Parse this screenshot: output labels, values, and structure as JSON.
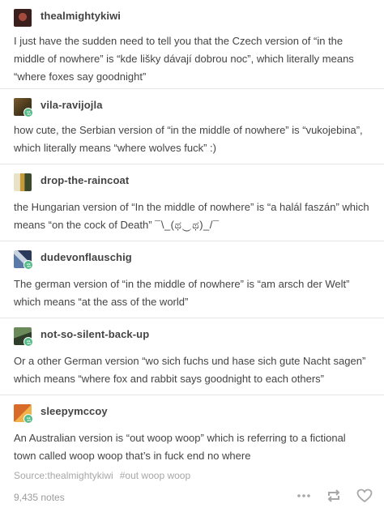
{
  "reblogs": [
    {
      "username": "thealmightykiwi",
      "text": "I just have the sudden need to tell you that the Czech version of “in the middle of nowhere” is “kde lišky dávají dobrou noc”, which literally means “where foxes say goodnight”"
    },
    {
      "username": "vila-ravijojla",
      "text": "how cute, the Serbian version of “in the middle of nowhere” is “vukojebina”, which literally means “where wolves fuck” :)"
    },
    {
      "username": "drop-the-raincoat",
      "text": "the Hungarian version of “In the middle of nowhere” is “a halál faszán” which means “on the cock of Death”",
      "emote": "¯\\_(ಥ‿ಥ)_/¯"
    },
    {
      "username": "dudevonflauschig",
      "text": "The german version of “in the middle of nowhere” is “am arsch der Welt” which means “at the ass of the world”"
    },
    {
      "username": "not-so-silent-back-up",
      "text": "Or a other German version “wo sich fuchs und hase sich gute Nacht sagen” which means “where fox and rabbit says goodnight to each others”"
    },
    {
      "username": "sleepymccoy",
      "text": "An Australian version is “out woop woop” which is referring to a fictional town called woop woop that’s in fuck end no where"
    }
  ],
  "footer": {
    "source_label": "Source:",
    "source_value": "thealmightykiwi",
    "tag": "#out woop woop",
    "notes": "9,435 notes"
  },
  "icons": {
    "more": "more-dots-icon",
    "reblog": "reblog-icon",
    "like": "heart-icon"
  },
  "colors": {
    "text": "#444444",
    "muted": "#a7a7a7",
    "reblog_badge": "#56bc8a"
  }
}
